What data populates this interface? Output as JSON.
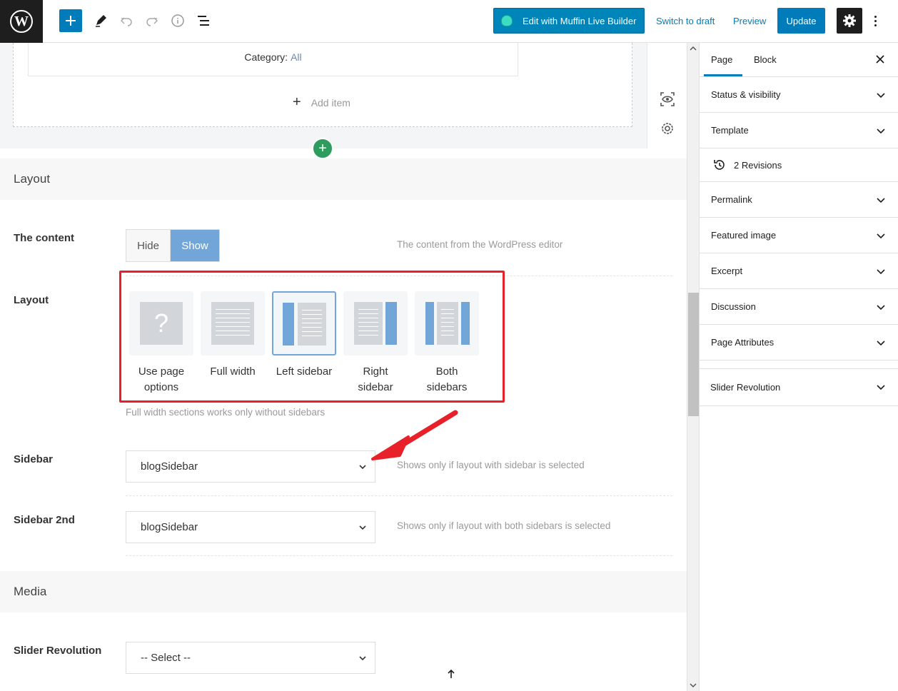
{
  "toolbar": {
    "muffin_label": "Edit with Muffin Live Builder",
    "switch_draft": "Switch to draft",
    "preview": "Preview",
    "update": "Update"
  },
  "block": {
    "category_label": "Category:",
    "category_value": "All",
    "add_item": "Add item"
  },
  "layout_section": {
    "title": "Layout",
    "content_label": "The content",
    "hide": "Hide",
    "show": "Show",
    "content_hint": "The content from the WordPress editor",
    "layout_label": "Layout",
    "options": [
      {
        "line1": "Use page",
        "line2": "options"
      },
      {
        "line1": "Full width",
        "line2": ""
      },
      {
        "line1": "Left sidebar",
        "line2": ""
      },
      {
        "line1": "Right",
        "line2": "sidebar"
      },
      {
        "line1": "Both",
        "line2": "sidebars"
      }
    ],
    "selected_option": "Left sidebar",
    "full_width_hint": "Full width sections works only without sidebars",
    "sidebar_label": "Sidebar",
    "sidebar_value": "blogSidebar",
    "sidebar_hint": "Shows only if layout with sidebar is selected",
    "sidebar2_label": "Sidebar 2nd",
    "sidebar2_value": "blogSidebar",
    "sidebar2_hint": "Shows only if layout with both sidebars is selected"
  },
  "media_section": {
    "title": "Media",
    "slider_label": "Slider Revolution",
    "slider_value": "-- Select --"
  },
  "sidebar": {
    "tab_page": "Page",
    "tab_block": "Block",
    "panels": [
      "Status & visibility",
      "Template",
      "2 Revisions",
      "Permalink",
      "Featured image",
      "Excerpt",
      "Discussion",
      "Page Attributes",
      "Slider Revolution"
    ]
  },
  "colors": {
    "wp_blue": "#007cba",
    "accent_blue": "#72a5d8",
    "annotation_red": "#e8202a",
    "green": "#2f9c5f"
  }
}
